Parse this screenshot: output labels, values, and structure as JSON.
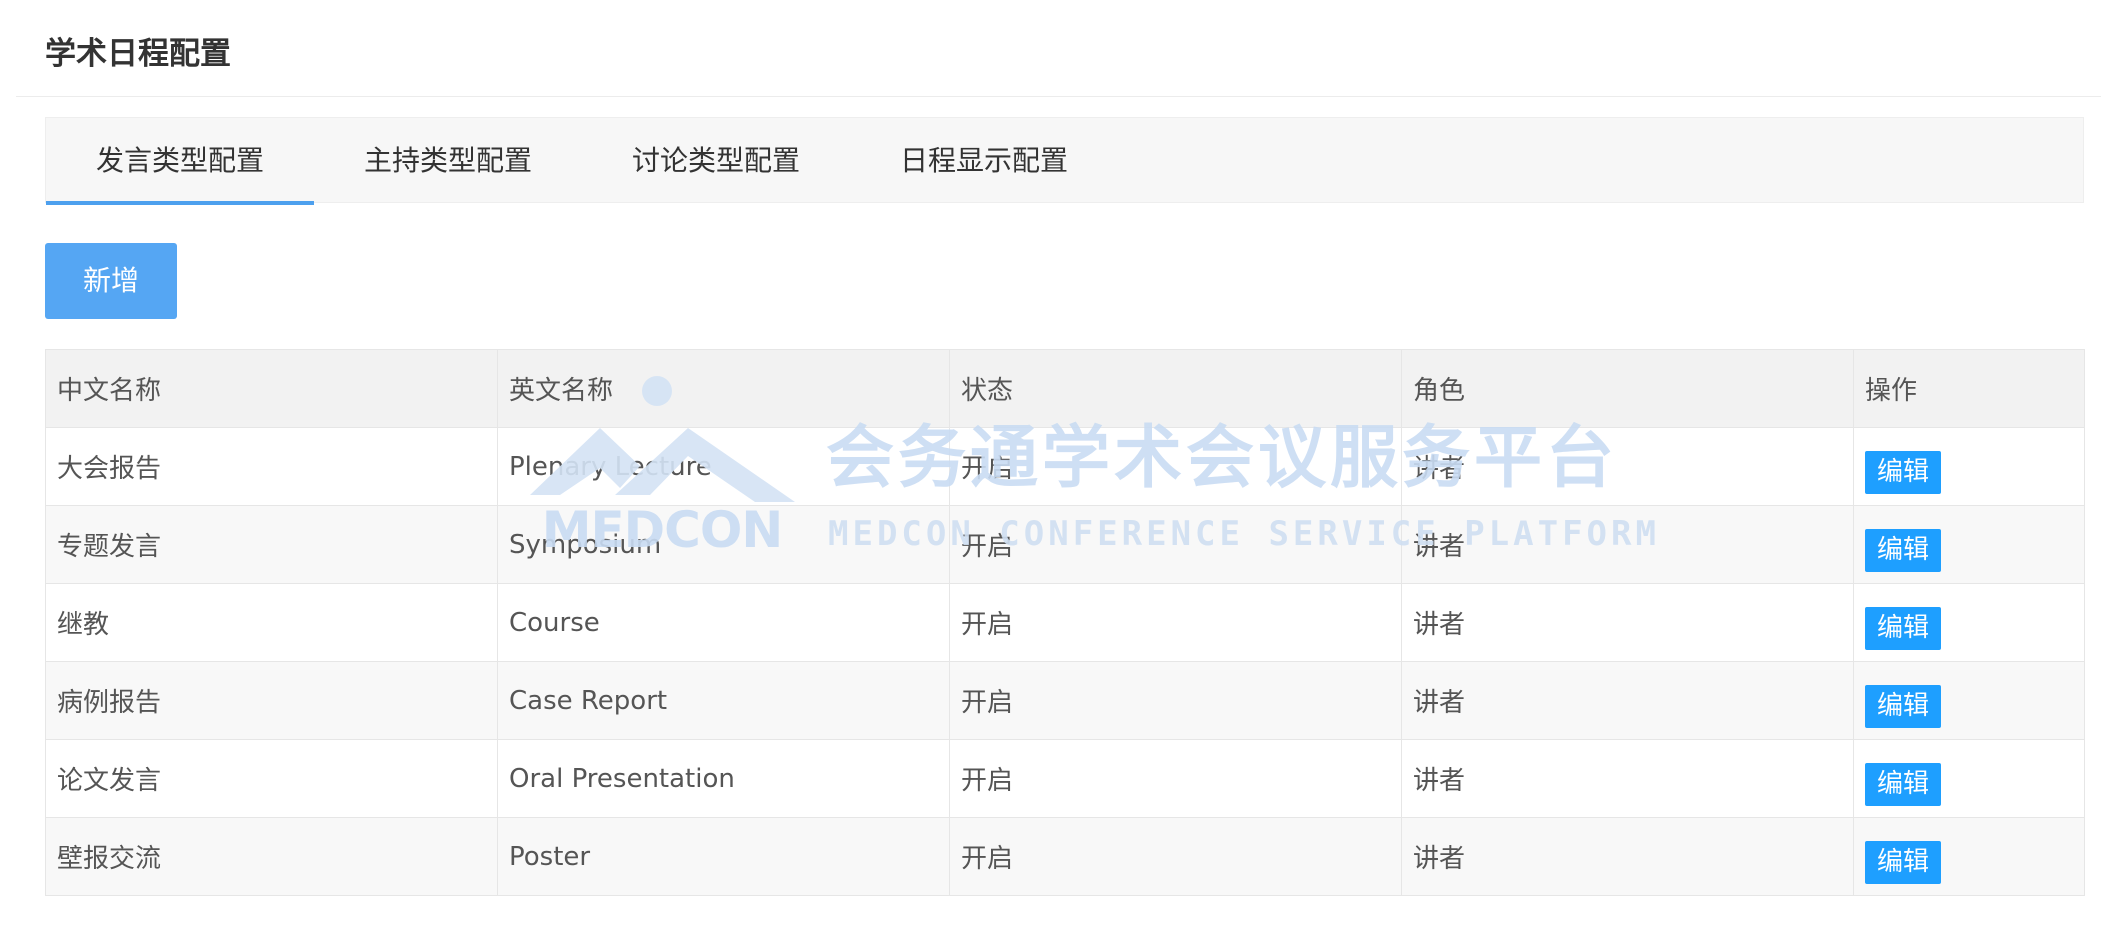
{
  "page": {
    "title": "学术日程配置"
  },
  "tabs": [
    {
      "label": "发言类型配置",
      "active": true
    },
    {
      "label": "主持类型配置",
      "active": false
    },
    {
      "label": "讨论类型配置",
      "active": false
    },
    {
      "label": "日程显示配置",
      "active": false
    }
  ],
  "toolbar": {
    "add_label": "新增"
  },
  "table": {
    "columns": [
      "中文名称",
      "英文名称",
      "状态",
      "角色",
      "操作"
    ],
    "rows": [
      {
        "cn_name": "大会报告",
        "en_name": "Plenary Lecture",
        "status": "开启",
        "role": "讲者",
        "action": "编辑"
      },
      {
        "cn_name": "专题发言",
        "en_name": "Symposium",
        "status": "开启",
        "role": "讲者",
        "action": "编辑"
      },
      {
        "cn_name": "继教",
        "en_name": "Course",
        "status": "开启",
        "role": "讲者",
        "action": "编辑"
      },
      {
        "cn_name": "病例报告",
        "en_name": "Case Report",
        "status": "开启",
        "role": "讲者",
        "action": "编辑"
      },
      {
        "cn_name": "论文发言",
        "en_name": "Oral Presentation",
        "status": "开启",
        "role": "讲者",
        "action": "编辑"
      },
      {
        "cn_name": "壁报交流",
        "en_name": "Poster",
        "status": "开启",
        "role": "讲者",
        "action": "编辑"
      }
    ]
  },
  "watermark": {
    "logo_text": "MEDCON",
    "title_cn": "会务通学术会议服务平台",
    "title_en": "MEDCON CONFERENCE SERVICE PLATFORM"
  },
  "colors": {
    "primary": "#55a6f3",
    "edit_button": "#1e9fff",
    "tab_indicator": "#4da0ee",
    "watermark": "#c9dcf3"
  }
}
